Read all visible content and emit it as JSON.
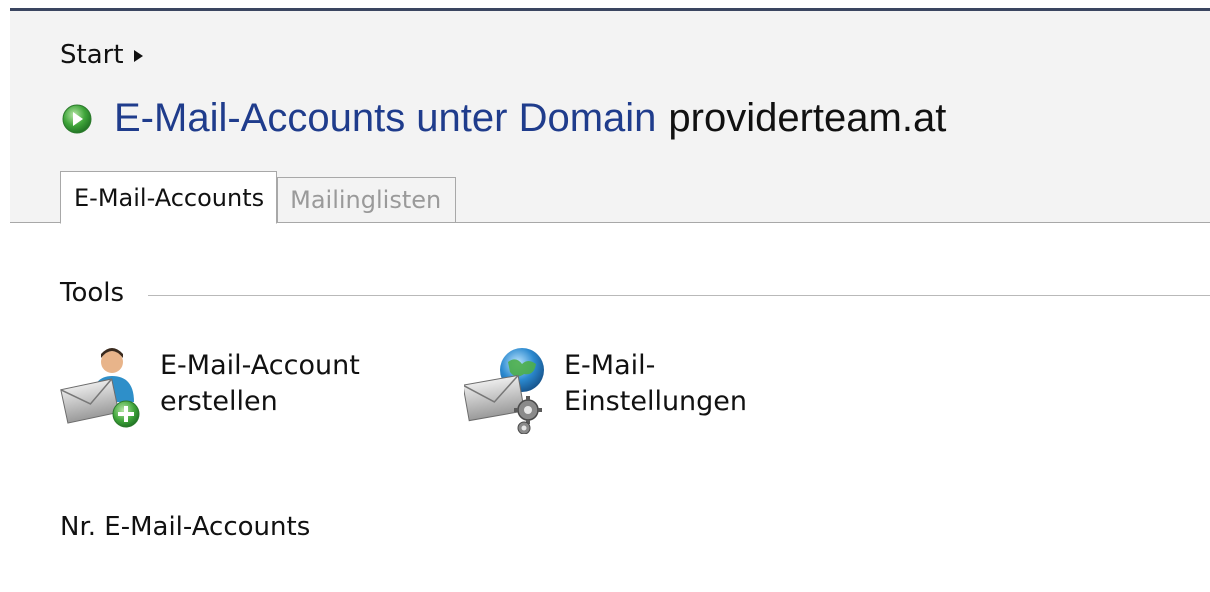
{
  "breadcrumb": {
    "start": "Start"
  },
  "header": {
    "title": "E-Mail-Accounts unter Domain",
    "domain": "providerteam.at"
  },
  "tabs": [
    {
      "label": "E-Mail-Accounts",
      "active": true
    },
    {
      "label": "Mailinglisten",
      "active": false
    }
  ],
  "tools": {
    "section_label": "Tools",
    "items": [
      {
        "label_line1": "E-Mail-Account",
        "label_line2": "erstellen",
        "icon": "add-mail-user-icon"
      },
      {
        "label_line1": "E-Mail-",
        "label_line2": "Einstellungen",
        "icon": "mail-settings-icon"
      }
    ]
  },
  "list": {
    "count_label": "Nr. E-Mail-Accounts"
  },
  "colors": {
    "title_blue": "#1f3c8c",
    "header_bg": "#f3f3f3",
    "go_green": "#3fa53a",
    "inactive_tab_text": "#9a9a9a"
  }
}
